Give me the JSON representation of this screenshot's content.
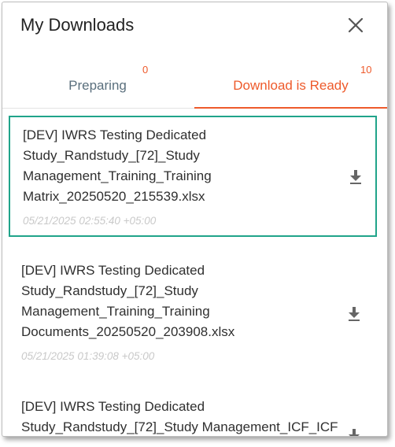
{
  "header": {
    "title": "My Downloads",
    "close_icon": "close-icon"
  },
  "tabs": [
    {
      "label": "Preparing",
      "count": "0",
      "active": false
    },
    {
      "label": "Download is Ready",
      "count": "10",
      "active": true
    }
  ],
  "colors": {
    "accent": "#ee5a2b",
    "selected_border": "#20a48a",
    "inactive_tab": "#5a6f7d"
  },
  "downloads": [
    {
      "lines": [
        "[DEV] IWRS Testing Dedicated",
        "Study_Randstudy_[72]_Study",
        "Management_Training_Training",
        "Matrix_20250520_215539.xlsx"
      ],
      "date": "05/21/2025 02:55:40 +05:00",
      "icon": "download-icon"
    },
    {
      "lines": [
        "[DEV] IWRS Testing Dedicated",
        "Study_Randstudy_[72]_Study",
        "Management_Training_Training",
        "Documents_20250520_203908.xlsx"
      ],
      "date": "05/21/2025 01:39:08 +05:00",
      "icon": "download-icon"
    },
    {
      "lines": [
        "[DEV] IWRS Testing Dedicated",
        "Study_Randstudy_[72]_Study Management_ICF_ICF"
      ],
      "date": "",
      "icon": "download-icon"
    }
  ]
}
